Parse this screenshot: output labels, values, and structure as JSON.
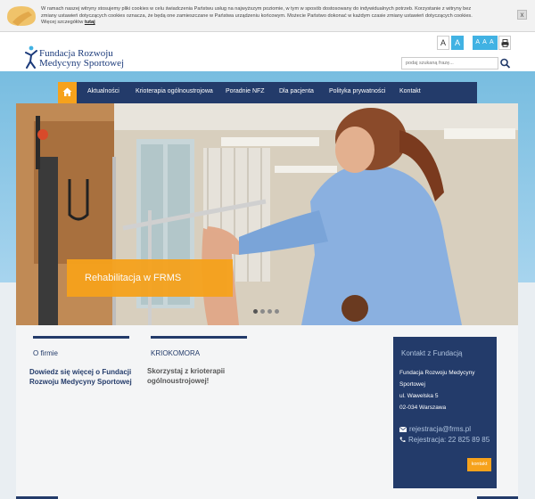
{
  "cookie": {
    "text": "W ramach naszej witryny stosujemy pliki cookies w celu świadczenia Państwu usług na najwyższym poziomie, w tym w sposób dostosowany do indywidualnych potrzeb. Korzystanie z witryny bez zmiany ustawień dotyczących cookies oznacza, że będą one zamieszczane w Państwa urządzeniu końcowym. Możecie Państwo dokonać w każdym czasie zmiany ustawień dotyczących cookies. Więcej szczegółów",
    "link": "tutaj",
    "close": "x"
  },
  "header": {
    "logo_line1": "Fundacja Rozwoju",
    "logo_line2": "Medycyny Sportowej",
    "font_a_normal": "A",
    "font_a_contrast": "A",
    "font_sizes": "A A A",
    "search_placeholder": "podaj szukaną frazę..."
  },
  "nav": {
    "items": [
      {
        "label": "Aktualności"
      },
      {
        "label": "Krioterapia ogólnoustrojowa"
      },
      {
        "label": "Poradnie NFZ"
      },
      {
        "label": "Dla pacjenta"
      },
      {
        "label": "Polityka prywatności"
      },
      {
        "label": "Kontakt"
      }
    ]
  },
  "slider": {
    "caption": "Rehabilitacja w FRMS"
  },
  "columns": [
    {
      "title": "O firmie",
      "text": "Dowiedz się więcej o Fundacji Rozwoju Medycyny Sportowej"
    },
    {
      "title": "KRIOKOMORA",
      "text": "Skorzystaj z krioterapii ogólnoustrojowej!"
    }
  ],
  "contact": {
    "title": "Kontakt z Fundacją",
    "name1": "Fundacja Rozwoju Medycyny",
    "name2": "Sportowej",
    "street": "ul. Wawelska 5",
    "city": "02-034 Warszawa",
    "email": "rejestracja@frms.pl",
    "phone": "Rejestracja: 22 825 89 85",
    "button": "kontakt"
  },
  "colors": {
    "navy": "#233b6a",
    "orange": "#f6a21c",
    "sky": "#78bde0"
  }
}
